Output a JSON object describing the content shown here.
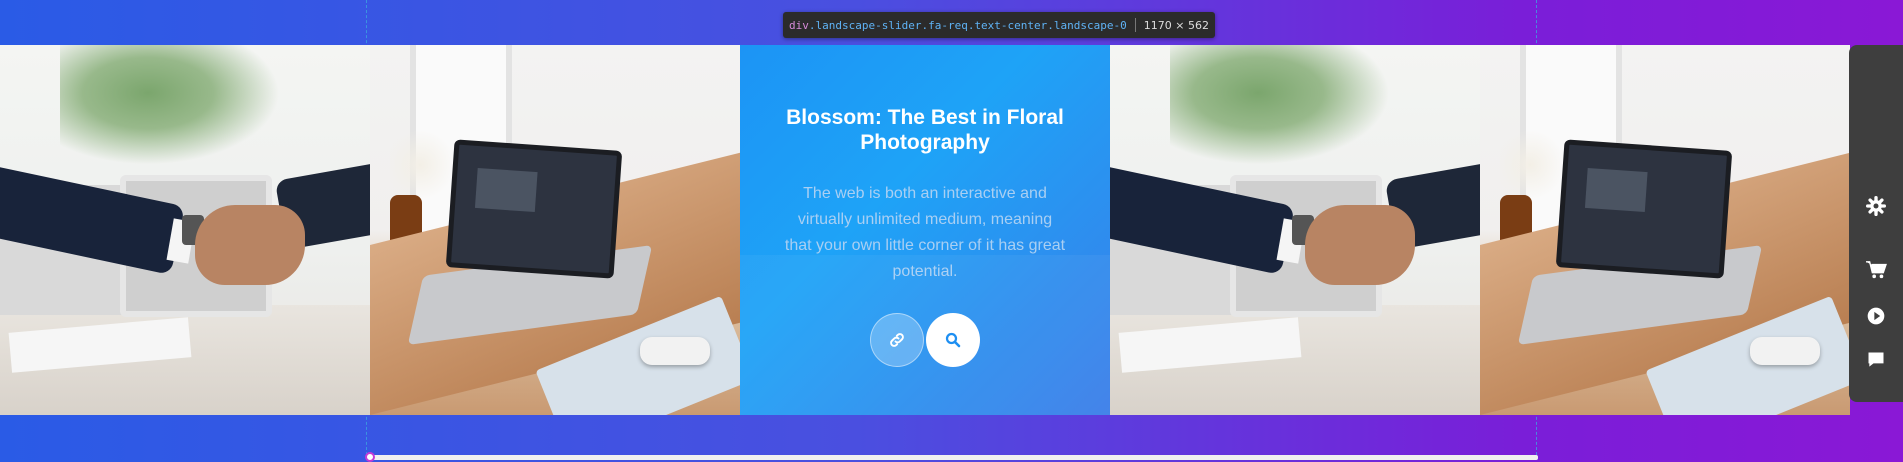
{
  "inspector": {
    "tag": "div",
    "classes": ".landscape-slider.fa-req.text-center.landscape-0",
    "dimensions": "1170 × 562"
  },
  "slider": {
    "tiles": [
      "handshake-photo",
      "laptop-desk-photo",
      "feature-card",
      "handshake-photo",
      "laptop-desk-photo"
    ],
    "card": {
      "title": "Blossom: The Best in Floral Photography",
      "body": "The web is both an interactive and virtually unlimited medium, meaning that your own little corner of it has great potential.",
      "buttons": [
        {
          "icon": "link-icon"
        },
        {
          "icon": "search-icon"
        }
      ]
    }
  },
  "side_panel": {
    "items": [
      {
        "icon": "gear-icon"
      },
      {
        "icon": "cart-icon"
      },
      {
        "icon": "play-icon"
      },
      {
        "icon": "chat-icon"
      }
    ]
  },
  "colors": {
    "background_start": "#2a5be6",
    "background_end": "#8a18d6",
    "card_blue": "#1ea3f7",
    "panel": "#3e3e3e"
  }
}
